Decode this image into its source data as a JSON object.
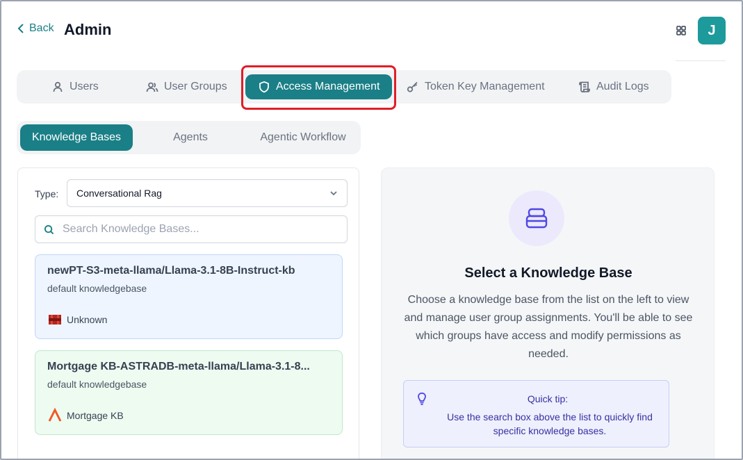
{
  "header": {
    "back_label": "Back",
    "title": "Admin",
    "avatar_initial": "J"
  },
  "main_tabs": [
    {
      "label": "Users",
      "icon": "user-icon",
      "active": false
    },
    {
      "label": "User Groups",
      "icon": "users-icon",
      "active": false
    },
    {
      "label": "Access Management",
      "icon": "shield-icon",
      "active": true
    },
    {
      "label": "Token Key Management",
      "icon": "key-icon",
      "active": false
    },
    {
      "label": "Audit Logs",
      "icon": "scroll-icon",
      "active": false
    }
  ],
  "sub_tabs": [
    {
      "label": "Knowledge Bases",
      "active": true
    },
    {
      "label": "Agents",
      "active": false
    },
    {
      "label": "Agentic Workflow",
      "active": false
    }
  ],
  "filter": {
    "type_label": "Type:",
    "type_value": "Conversational Rag",
    "search_placeholder": "Search Knowledge Bases..."
  },
  "knowledge_bases": [
    {
      "title": "newPT-S3-meta-llama/Llama-3.1-8B-Instruct-kb",
      "subtitle": "default knowledgebase",
      "source": "Unknown",
      "source_icon": "aws-s3-icon"
    },
    {
      "title": "Mortgage KB-ASTRADB-meta-llama/Llama-3.1-8...",
      "subtitle": "default knowledgebase",
      "source": "Mortgage KB",
      "source_icon": "astradb-icon"
    }
  ],
  "detail": {
    "title": "Select a Knowledge Base",
    "description": "Choose a knowledge base from the list on the left to view and manage user group assignments. You'll be able to see which groups have access and modify permissions as needed.",
    "tip_title": "Quick tip:",
    "tip_body": "Use the search box above the list to quickly find specific knowledge bases."
  },
  "colors": {
    "accent": "#1a7f86",
    "highlight": "#e11d26",
    "indigo": "#4f46e5"
  }
}
